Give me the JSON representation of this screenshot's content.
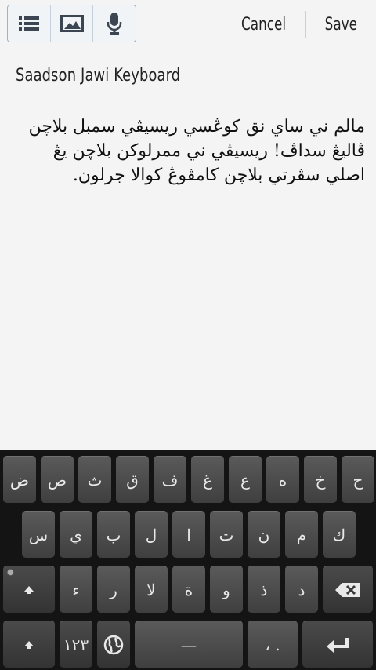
{
  "toolbar": {
    "icons": [
      "list-icon",
      "image-icon",
      "microphone-icon"
    ]
  },
  "actions": {
    "cancel": "Cancel",
    "save": "Save"
  },
  "note": {
    "title": "Saadson Jawi Keyboard",
    "body": "مالم ني ساي نق كوڠسي ريسيڤي سمبل بلاچن ڤاليڠ سداڤ! ريسيڤي ني ممرلوكن بلاچن يڠ اصلي سڤرتي بلاچن كامڤوڠ كوالا جرلون."
  },
  "keyboard": {
    "row1": [
      "ض",
      "ص",
      "ث",
      "ق",
      "ف",
      "غ",
      "ع",
      "ه",
      "خ",
      "ح"
    ],
    "row2": [
      "س",
      "ي",
      "ب",
      "ل",
      "ا",
      "ت",
      "ن",
      "م",
      "ك"
    ],
    "row3": [
      "ء",
      "ر",
      "لا",
      "ة",
      "و",
      "ذ",
      "د"
    ],
    "numbers_label": "١٢٣",
    "punct_label": "، .",
    "space_label": "—"
  }
}
